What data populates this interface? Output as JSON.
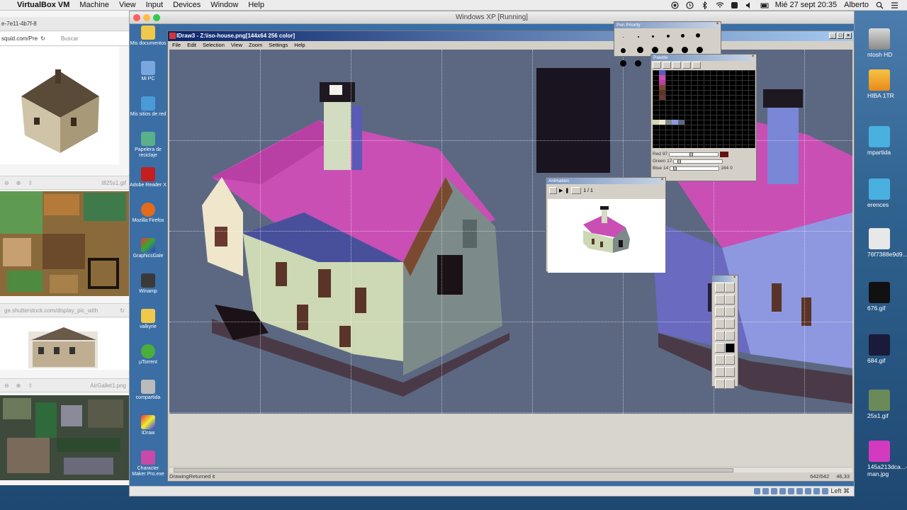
{
  "mac_menubar": {
    "app_name": "VirtualBox VM",
    "menus": [
      "Machine",
      "View",
      "Input",
      "Devices",
      "Window",
      "Help"
    ],
    "datetime": "Mié 27 sept  20:35",
    "user": "Alberto"
  },
  "browser": {
    "tab_title": "e-7e11-4b7f-8",
    "url": "squid.com/Pre",
    "search_placeholder": "Buscar",
    "file1": "t825s1.gif",
    "url2": "ge.shutterstock.com/display_pic_with",
    "file2": "AirGallet1.png"
  },
  "vbox": {
    "title": "Windows XP [Running]",
    "status_right": "Left ⌘"
  },
  "xp_icons": [
    {
      "label": "Mis documentos"
    },
    {
      "label": "Mi PC"
    },
    {
      "label": "Mis sitios de red"
    },
    {
      "label": "Papelera de reciclaje"
    },
    {
      "label": "Adobe Reader X"
    },
    {
      "label": "Mozilla Firefox"
    },
    {
      "label": "GraphicsGale"
    },
    {
      "label": "Winamp"
    },
    {
      "label": "valkyrie"
    },
    {
      "label": "µTorrent"
    },
    {
      "label": "compartida"
    },
    {
      "label": "IDraw"
    },
    {
      "label": "Character Maker Pro.exe"
    }
  ],
  "idraw": {
    "title": "IDraw3 - Z:\\iso-house.png[144x64 256 color]",
    "menus": [
      "File",
      "Edit",
      "Selection",
      "View",
      "Zoom",
      "Settings",
      "Help"
    ],
    "status_text": "DrawingReturned it",
    "status_size": "642/642",
    "status_pos": "46,33"
  },
  "pen_window": {
    "title": "Pen Priority"
  },
  "palette_window": {
    "title": "Palette",
    "red_label": "Red",
    "red_value": "97",
    "green_label": "Green",
    "green_value": "17",
    "blue_label": "Blue",
    "blue_value": "14",
    "index_value": "164",
    "index2": "0"
  },
  "animation_window": {
    "title": "Animation",
    "frame_label": "1 / 1"
  },
  "mac_right_icons": [
    {
      "label": "ntosh HD"
    },
    {
      "label": "HIBA 1TR"
    },
    {
      "label": "mpartida"
    },
    {
      "label": "erences"
    },
    {
      "label": "76f7388e9d9...e76aa.gif"
    },
    {
      "label": "676.gif"
    },
    {
      "label": "684.gif"
    },
    {
      "label": "25s1.gif"
    },
    {
      "label": "145a213dca...-man.jpg"
    }
  ],
  "colors": {
    "canvas_bg": "#5c6882",
    "roof": "#c94fb5",
    "xp_desktop": "#3a6ea5"
  }
}
